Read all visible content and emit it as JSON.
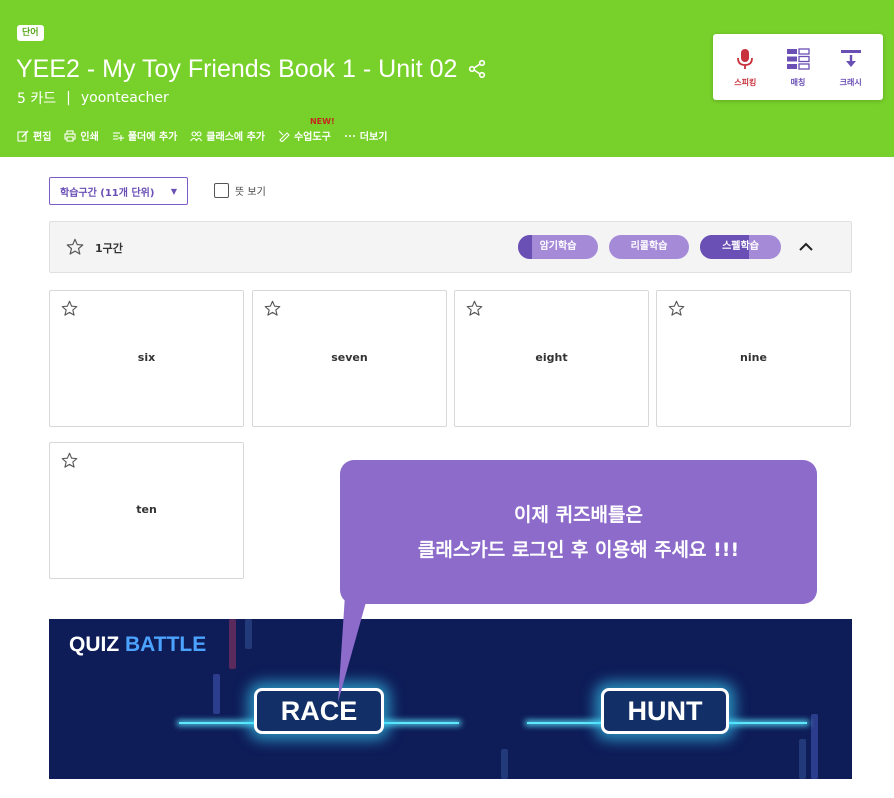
{
  "header": {
    "badge": "단어",
    "title": "YEE2 - My Toy Friends Book 1 - Unit 02",
    "card_count": "5 카드",
    "separator": "|",
    "author": "yoonteacher",
    "toolbar": [
      {
        "label": "편집",
        "icon": "edit-icon"
      },
      {
        "label": "인쇄",
        "icon": "print-icon"
      },
      {
        "label": "폴더에 추가",
        "icon": "folder-add-icon"
      },
      {
        "label": "클래스에 추가",
        "icon": "class-add-icon"
      },
      {
        "label": "수업도구",
        "icon": "tool-icon",
        "tag": "NEW!"
      },
      {
        "label": "더보기",
        "icon": "more-icon"
      }
    ],
    "modes": [
      {
        "label": "스피킹",
        "icon": "microphone-icon",
        "color": "#c8323c"
      },
      {
        "label": "매칭",
        "icon": "matching-icon",
        "color": "#6a4fb5"
      },
      {
        "label": "크래시",
        "icon": "crash-icon",
        "color": "#6a4fb5"
      }
    ]
  },
  "controls": {
    "range_select": "학습구간 (11개 단위)",
    "meaning_checkbox": "뜻 보기"
  },
  "section": {
    "label": "1구간",
    "buttons": [
      {
        "label": "암기학습",
        "progress": 0.18,
        "fill_color": "#6a4fb5",
        "base_color": "#a58ad8"
      },
      {
        "label": "리콜학습",
        "progress": 0.0,
        "fill_color": "#6a4fb5",
        "base_color": "#a58ad8"
      },
      {
        "label": "스펠학습",
        "progress": 0.6,
        "fill_color": "#6a4fb5",
        "base_color": "#a58ad8"
      }
    ]
  },
  "cards": [
    "six",
    "seven",
    "eight",
    "nine",
    "ten"
  ],
  "banner": {
    "title_part1": "QUIZ ",
    "title_part2": "BATTLE",
    "race_label": "RACE",
    "hunt_label": "HUNT"
  },
  "tooltip": {
    "line1": "이제 퀴즈배틀은",
    "line2": "클래스카드 로그인 후 이용해 주세요 !!!"
  },
  "colors": {
    "header_green": "#78d12a",
    "accent_purple": "#6a4fb5",
    "tooltip_purple": "#8c6bcb",
    "banner_navy": "#0e1c58"
  }
}
